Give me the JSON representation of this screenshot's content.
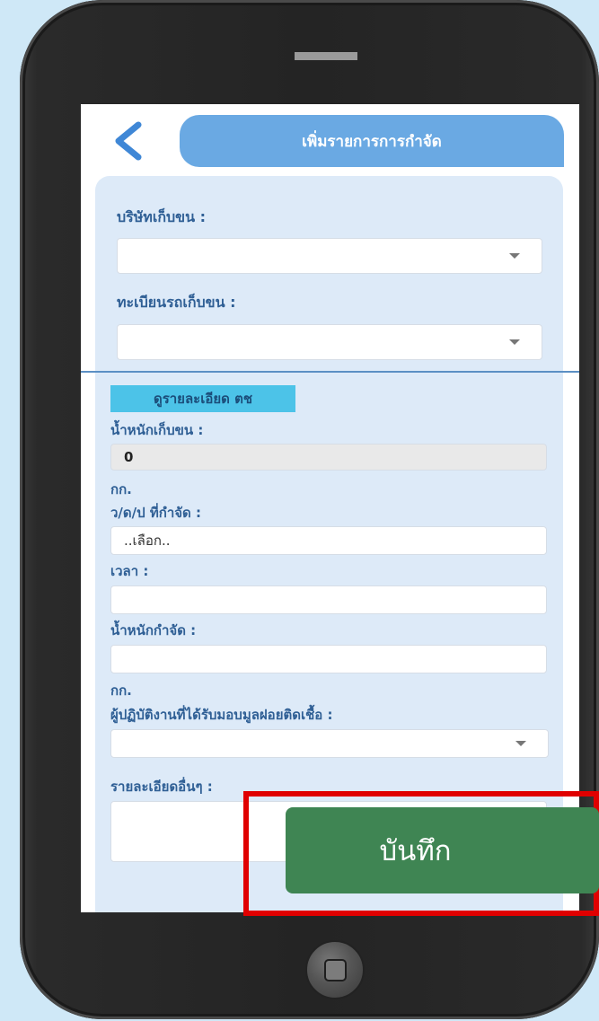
{
  "header": {
    "title": "เพิ่มรายการการกำจัด"
  },
  "form": {
    "company_label": "บริษัทเก็บขน :",
    "company_value": "",
    "plate_label": "ทะเบียนรถเก็บขน :",
    "plate_value": "",
    "detail_button": "ดูรายละเอียด ตช",
    "collect_weight_label": "น้ำหนักเก็บขน :",
    "collect_weight_value": "0",
    "collect_weight_unit": "กก.",
    "date_label": "ว/ด/ป ที่กำจัด :",
    "date_value": "..เลือก..",
    "time_label": "เวลา :",
    "time_value": "",
    "dispose_weight_label": "น้ำหนักกำจัด :",
    "dispose_weight_value": "",
    "dispose_weight_unit": "กก.",
    "officer_label": "ผู้ปฏิบัติงานที่ได้รับมอบมูลฝอยติดเชื้อ :",
    "officer_value": "",
    "notes_label": "รายละเอียดอื่นๆ :",
    "notes_value": ""
  },
  "save_button": "บันทึก",
  "colors": {
    "header_pill": "#6aa9e3",
    "panel": "#ddeaf8",
    "label_text": "#2f5f95",
    "detail_button": "#4cc3e8",
    "save_button": "#3f8553",
    "highlight": "#e00000",
    "background": "#cfe8f7"
  },
  "icons": {
    "back": "chevron-left-icon",
    "dropdown": "caret-down-icon",
    "home": "home-button"
  }
}
